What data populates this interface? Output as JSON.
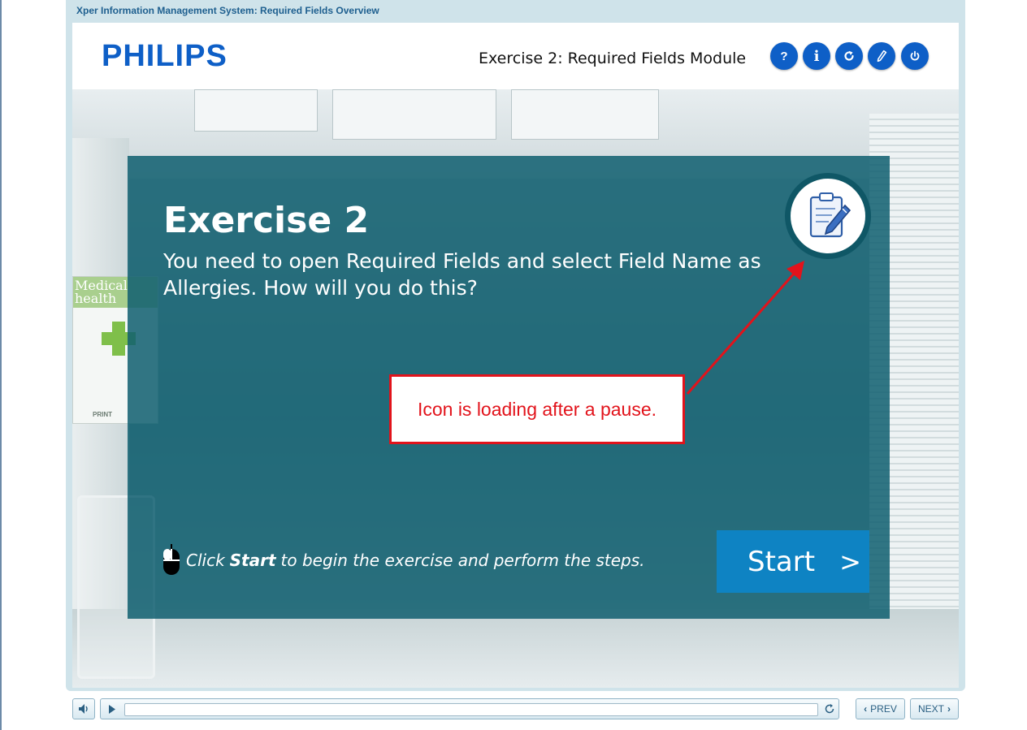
{
  "window": {
    "title": "Xper Information Management System: Required Fields Overview"
  },
  "header": {
    "logo": "PHILIPS",
    "module_title": "Exercise 2: Required Fields Module",
    "buttons": [
      {
        "name": "help",
        "label": "?"
      },
      {
        "name": "info",
        "label": "i"
      },
      {
        "name": "replay",
        "icon": "refresh-icon"
      },
      {
        "name": "glossary",
        "icon": "pen-icon"
      },
      {
        "name": "exit",
        "icon": "power-icon"
      }
    ]
  },
  "background": {
    "poster_text": "Medical health",
    "poster_print": "PRINT"
  },
  "exercise": {
    "title": "Exercise 2",
    "text": "You need to open Required Fields and select Field Name as Allergies. How will you do this?",
    "instruction_prefix": "Click",
    "instruction_bold": "Start",
    "instruction_suffix": "to begin the exercise and perform the steps.",
    "start_label": "Start",
    "start_arrow": ">",
    "icon": "clipboard-pencil-icon"
  },
  "annotation": {
    "text": "Icon is loading after a pause.",
    "color": "#e2131b"
  },
  "playbar": {
    "mute_icon": "speaker-icon",
    "play_icon": "play-icon",
    "replay_icon": "rewind-icon",
    "progress": 0,
    "prev_label": "PREV",
    "next_label": "NEXT"
  },
  "colors": {
    "brand": "#0e5fc7",
    "overlay": "#106070",
    "start_button": "#0e83c3"
  }
}
